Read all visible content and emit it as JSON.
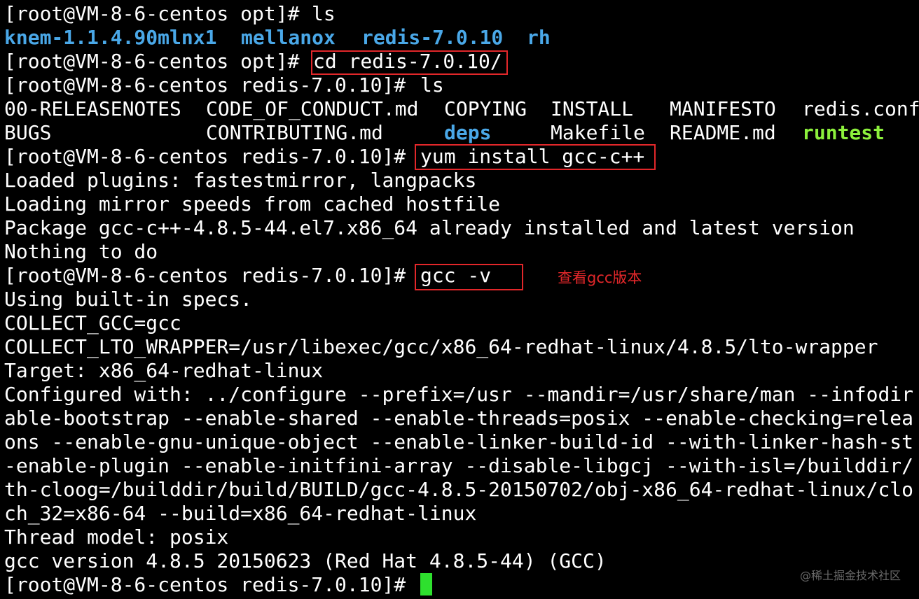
{
  "terminal": {
    "prompt_opt": "[root@VM-8-6-centos opt]# ",
    "prompt_redis": "[root@VM-8-6-centos redis-7.0.10]# ",
    "cmd_ls": "ls",
    "opt_listing": [
      "knem-1.1.4.90mlnx1",
      "mellanox",
      "redis-7.0.10",
      "rh"
    ],
    "cmd_cd": "cd redis-7.0.10/",
    "redis_listing_row1": [
      "00-RELEASENOTES",
      "CODE_OF_CONDUCT.md",
      "COPYING",
      "INSTALL",
      "MANIFESTO",
      "redis.conf"
    ],
    "redis_listing_row2": [
      "BUGS",
      "CONTRIBUTING.md",
      "deps",
      "Makefile",
      "README.md",
      "runtest"
    ],
    "cmd_yum": "yum install gcc-c++",
    "yum_output": [
      "Loaded plugins: fastestmirror, langpacks",
      "Loading mirror speeds from cached hostfile",
      "Package gcc-c++-4.8.5-44.el7.x86_64 already installed and latest version",
      "Nothing to do"
    ],
    "cmd_gcc": "gcc -v",
    "gcc_output": [
      "Using built-in specs.",
      "COLLECT_GCC=gcc",
      "COLLECT_LTO_WRAPPER=/usr/libexec/gcc/x86_64-redhat-linux/4.8.5/lto-wrapper",
      "Target: x86_64-redhat-linux",
      "Configured with: ../configure --prefix=/usr --mandir=/usr/share/man --infodir",
      "able-bootstrap --enable-shared --enable-threads=posix --enable-checking=relea",
      "ons --enable-gnu-unique-object --enable-linker-build-id --with-linker-hash-st",
      "-enable-plugin --enable-initfini-array --disable-libgcj --with-isl=/builddir/",
      "th-cloog=/builddir/build/BUILD/gcc-4.8.5-20150702/obj-x86_64-redhat-linux/clo",
      "ch_32=x86-64 --build=x86_64-redhat-linux",
      "Thread model: posix",
      "gcc version 4.8.5 20150623 (Red Hat 4.8.5-44) (GCC)"
    ]
  },
  "annotation": {
    "gcc_note": "查看gcc版本"
  },
  "watermark": "@稀土掘金技术社区",
  "colors": {
    "background": "#000000",
    "text": "#ffffff",
    "directory": "#4aa8e8",
    "executable": "#8cf03c",
    "highlight_box": "#e2272a",
    "cursor": "#2ee02e"
  }
}
